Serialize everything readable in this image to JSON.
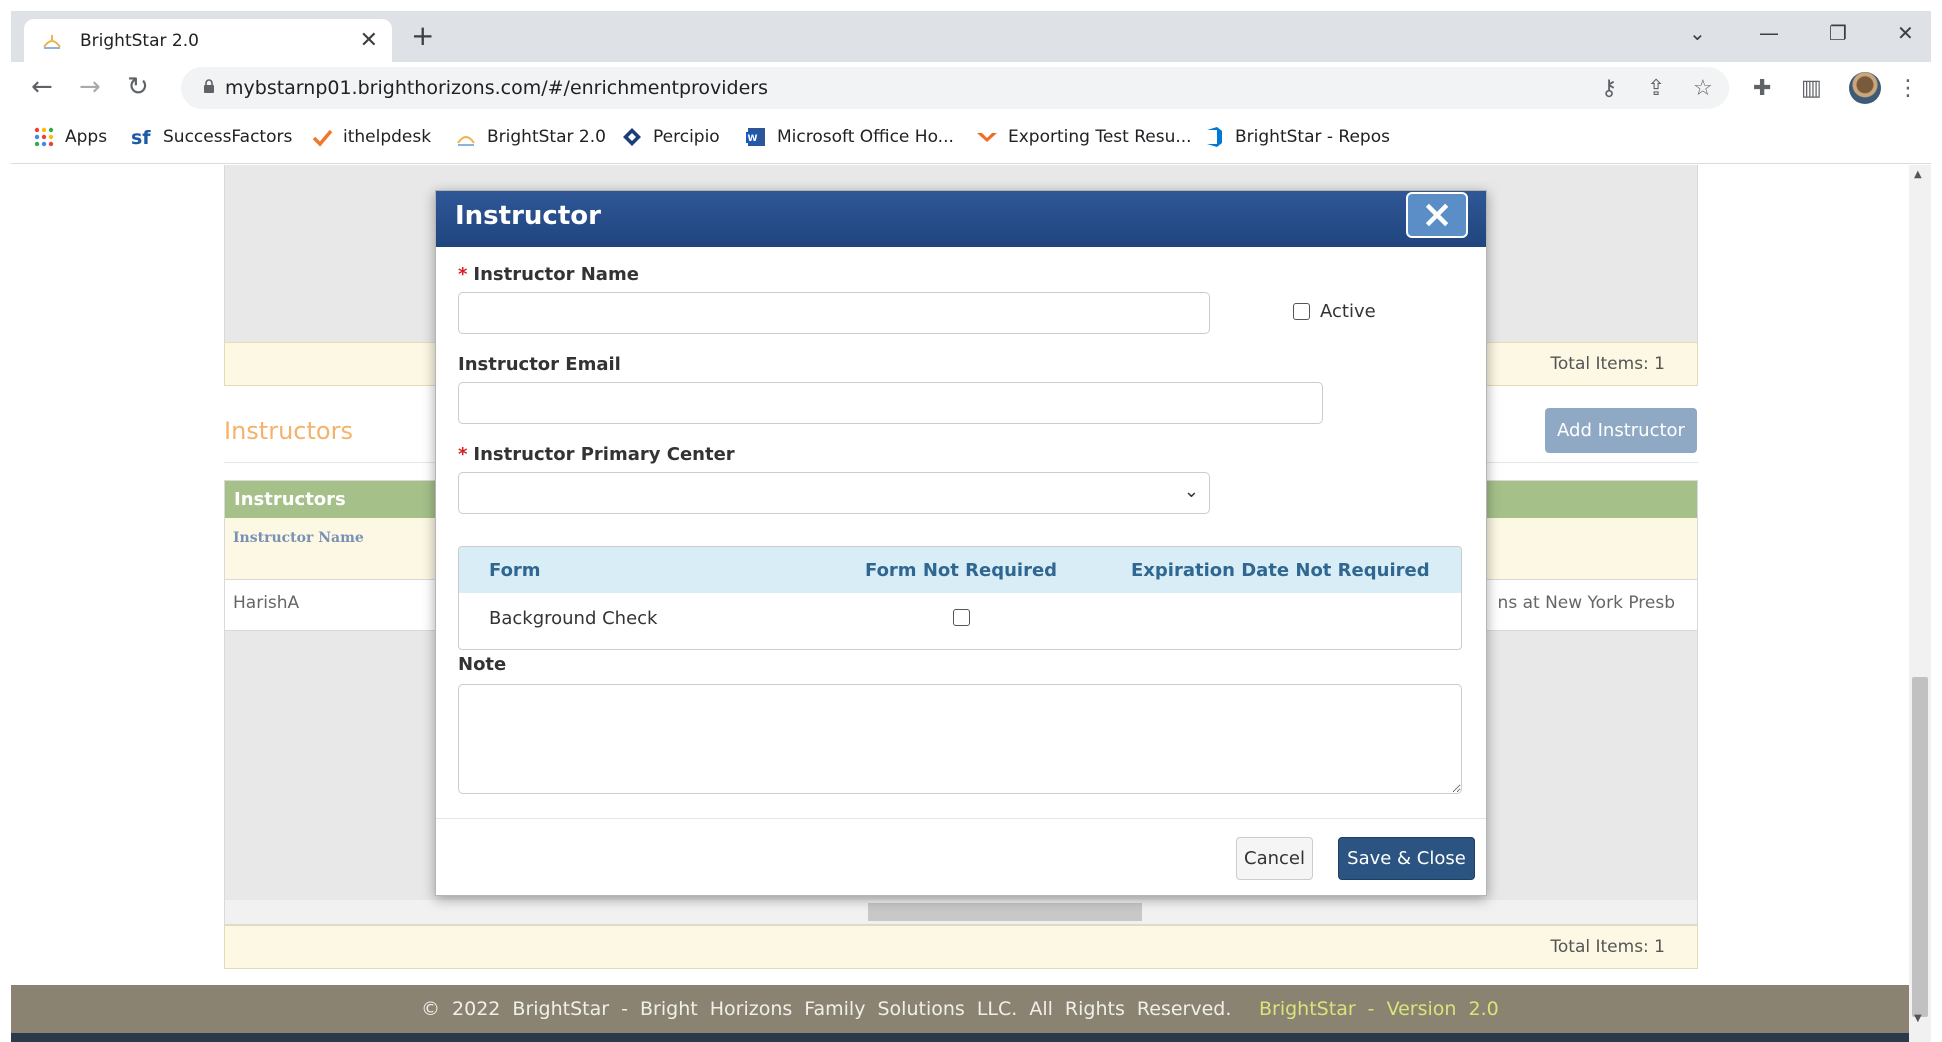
{
  "browser": {
    "tab_title": "BrightStar 2.0",
    "new_tab": "+",
    "url": "mybstarnp01.brighthorizons.com/#/enrichmentproviders",
    "bookmarks": [
      {
        "label": "Apps"
      },
      {
        "label": "SuccessFactors"
      },
      {
        "label": "ithelpdesk"
      },
      {
        "label": "BrightStar 2.0"
      },
      {
        "label": "Percipio"
      },
      {
        "label": "Microsoft Office Ho..."
      },
      {
        "label": "Exporting Test Resu..."
      },
      {
        "label": "BrightStar - Repos"
      }
    ]
  },
  "page": {
    "top_grid_total": "Total Items: 1",
    "instructors_section_title": "Instructors",
    "add_instructor_button": "Add Instructor",
    "instructors_grid": {
      "caption": "Instructors",
      "column_instructor_name": "Instructor Name",
      "rows": [
        {
          "name": "HarishA",
          "center_partial": "ns at New York Presb"
        }
      ],
      "total": "Total Items: 1"
    },
    "footer": {
      "copyright": "© 2022 BrightStar - Bright Horizons Family Solutions LLC. All Rights Reserved.",
      "version": "BrightStar - Version 2.0"
    }
  },
  "modal": {
    "title": "Instructor",
    "close_glyph": "×",
    "required_mark": "*",
    "instructor_name_label": "Instructor Name",
    "instructor_name_value": "",
    "active_label": "Active",
    "active_checked": false,
    "instructor_email_label": "Instructor Email",
    "instructor_email_value": "",
    "primary_center_label": "Instructor Primary Center",
    "primary_center_value": "",
    "forms_table": {
      "headers": [
        "Form",
        "Form Not Required",
        "Expiration Date Not Required"
      ],
      "rows": [
        {
          "form": "Background Check",
          "form_not_required": false
        }
      ]
    },
    "note_label": "Note",
    "note_value": "",
    "cancel_button": "Cancel",
    "save_button": "Save & Close"
  },
  "colors": {
    "modal_header": "#20457e",
    "grid_caption": "#a6c08a",
    "section_title": "#f4b26b",
    "save_button": "#2b5482",
    "required": "#d62020"
  }
}
